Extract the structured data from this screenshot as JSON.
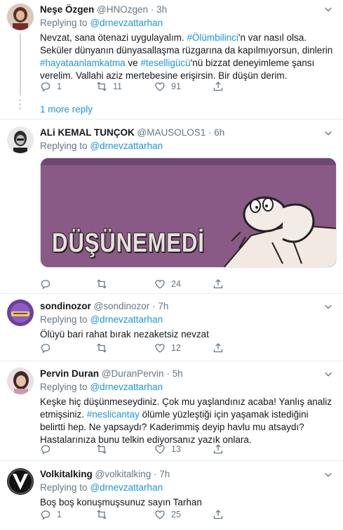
{
  "tweets": [
    {
      "name": "Neşe Özgen",
      "handle": "@HNOzgen",
      "time": "3h",
      "reply_prefix": "Replying to",
      "reply_to": "@drnevzattarhan",
      "text_parts": [
        "Nevzat, sana ötenazi uygulayalım. ",
        "#Ölümbilinci",
        "'n var nasıl olsa. Seküler dünyanın dünyasallaşma rüzgarına da kapılmıyorsun, dinlerin ",
        "#hayataanlamkatma",
        " ve ",
        "#teselligücü",
        "'nü bizzat deneyimleme şansı verelim. Vallahi aziz mertebesine erişirsin. Bir düşün derim."
      ],
      "replies": "1",
      "retweets": "11",
      "likes": "91"
    },
    {
      "name": "ALi KEMAL TUNÇOK",
      "handle": "@MAUSOLOS1",
      "time": "6h",
      "reply_prefix": "Replying to",
      "reply_to": "@drnevzattarhan",
      "image_caption": "DÜŞÜNEMEDİ",
      "replies": "",
      "retweets": "",
      "likes": "24"
    },
    {
      "name": "sondinozor",
      "handle": "@sondinozor",
      "time": "7h",
      "reply_prefix": "Replying to",
      "reply_to": "@drnevzattarhan",
      "text": "Ölüyü bari rahat bırak nezaketsiz nevzat",
      "replies": "",
      "retweets": "",
      "likes": "12"
    },
    {
      "name": "Pervin Duran",
      "handle": "@DuranPervin",
      "time": "5h",
      "reply_prefix": "Replying to",
      "reply_to": "@drnevzattarhan",
      "text_parts": [
        "Keşke hiç düşünmeseydiniz. Çok mu yaşlandınız acaba! Yanlış analiz etmişsiniz. ",
        "#neslicantay",
        "  ölümle yüzleştiği için yaşamak istediğini belirtti hep. Ne yapsaydı? Kaderimmiş deyip havlu mu atsaydı? Hastalarınıza bunu telkin ediyorsanız yazık onlara."
      ],
      "replies": "",
      "retweets": "",
      "likes": "13"
    },
    {
      "name": "Volkitalking",
      "handle": "@volkitalking",
      "time": "7h",
      "reply_prefix": "Replying to",
      "reply_to": "@drnevzattarhan",
      "text": "Boş boş konuşmuşsunuz sayın Tarhan",
      "replies": "1",
      "retweets": "",
      "likes": "25"
    }
  ],
  "more_replies": "1 more reply",
  "dot": "·",
  "icons": [
    "reply-icon",
    "retweet-icon",
    "like-icon",
    "share-icon",
    "caret-down-icon"
  ]
}
